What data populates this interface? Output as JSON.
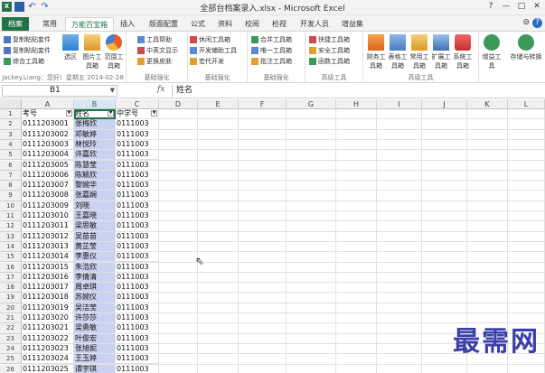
{
  "window": {
    "title": "全部台档案录入.xlsx - Microsoft Excel",
    "controls": [
      "?",
      "—",
      "□",
      "✕"
    ]
  },
  "tabs": [
    "档案",
    "常用",
    "万能百宝箱",
    "插入",
    "版面配置",
    "公式",
    "资料",
    "校阅",
    "检视",
    "开发人员",
    "增益集"
  ],
  "tab_right": [
    "⊝",
    "?"
  ],
  "ribbon": {
    "g1": {
      "rows": [
        "复制粘贴套件",
        "复制粘贴套件",
        "综合工具箱"
      ],
      "big": [
        "选区",
        "图片工具箱",
        "范围工具箱"
      ],
      "label": "Jackey.Liang：您好！星期五 2014-02-28"
    },
    "g2": {
      "rows": [
        "工具帮助",
        "中英文显示",
        "更换皮肤"
      ],
      "label": "基础强化"
    },
    "g3": {
      "rows": [
        "休闲工具箱",
        "开发辅助工具",
        "宏代开发"
      ],
      "label": "基础强化"
    },
    "g4": {
      "rows": [
        "合并工具箱",
        "唯一工具箱",
        "批注工具箱"
      ],
      "label": "基础强化"
    },
    "g5": {
      "rows": [
        "快捷工具箱",
        "安全工具箱",
        "函数工具箱"
      ],
      "label": "高级工具"
    },
    "g6": {
      "big": [
        "财务工具箱",
        "表格工具箱",
        "常用工具箱",
        "扩展工具箱",
        "系统工具箱"
      ],
      "label": "高级工具"
    },
    "g7": {
      "big": [
        "增益工具",
        "存储与转换"
      ],
      "label": ""
    }
  },
  "formula_bar": {
    "name_box": "B1",
    "fx": "fx",
    "value": "姓名"
  },
  "columns": [
    "A",
    "B",
    "C",
    "D",
    "E",
    "F",
    "G",
    "H",
    "I",
    "J",
    "K",
    "L",
    "M"
  ],
  "headers": {
    "a": "考号",
    "b": "姓名",
    "c": "中学号"
  },
  "rows": [
    {
      "n": "1"
    },
    {
      "n": "2",
      "a": "0111203001",
      "b": "张梅欣",
      "c": "0111003"
    },
    {
      "n": "3",
      "a": "0111203002",
      "b": "邓敏婷",
      "c": "0111003"
    },
    {
      "n": "4",
      "a": "0111203003",
      "b": "林悦玲",
      "c": "0111003"
    },
    {
      "n": "5",
      "a": "0111203004",
      "b": "许嘉欣",
      "c": "0111003"
    },
    {
      "n": "6",
      "a": "0111203005",
      "b": "陈慧莹",
      "c": "0111003"
    },
    {
      "n": "7",
      "a": "0111203006",
      "b": "陈颖欣",
      "c": "0111003"
    },
    {
      "n": "8",
      "a": "0111203007",
      "b": "黎婉华",
      "c": "0111003"
    },
    {
      "n": "9",
      "a": "0111203008",
      "b": "张嘉娴",
      "c": "0111003"
    },
    {
      "n": "10",
      "a": "0111203009",
      "b": "刘晓",
      "c": "0111003"
    },
    {
      "n": "11",
      "a": "0111203010",
      "b": "王嘉晓",
      "c": "0111003"
    },
    {
      "n": "12",
      "a": "0111203011",
      "b": "梁思敏",
      "c": "0111003"
    },
    {
      "n": "13",
      "a": "0111203012",
      "b": "吴苗苗",
      "c": "0111003"
    },
    {
      "n": "14",
      "a": "0111203013",
      "b": "黄芷莹",
      "c": "0111003"
    },
    {
      "n": "15",
      "a": "0111203014",
      "b": "李惠仪",
      "c": "0111003"
    },
    {
      "n": "16",
      "a": "0111203015",
      "b": "朱浩欣",
      "c": "0111003"
    },
    {
      "n": "17",
      "a": "0111203016",
      "b": "李倩清",
      "c": "0111003"
    },
    {
      "n": "18",
      "a": "0111203017",
      "b": "周卓琪",
      "c": "0111003"
    },
    {
      "n": "19",
      "a": "0111203018",
      "b": "苏婉仪",
      "c": "0111003"
    },
    {
      "n": "20",
      "a": "0111203019",
      "b": "吴洁莹",
      "c": "0111003"
    },
    {
      "n": "21",
      "a": "0111203020",
      "b": "许莎莎",
      "c": "0111003"
    },
    {
      "n": "22",
      "a": "0111203021",
      "b": "梁勇敏",
      "c": "0111003"
    },
    {
      "n": "23",
      "a": "0111203022",
      "b": "叶俊宏",
      "c": "0111003"
    },
    {
      "n": "24",
      "a": "0111203023",
      "b": "张旭妮",
      "c": "0111003"
    },
    {
      "n": "25",
      "a": "0111203024",
      "b": "王玉婷",
      "c": "0111003"
    },
    {
      "n": "26",
      "a": "0111203025",
      "b": "谭宇琪",
      "c": "0111003"
    }
  ],
  "watermark": "最需网"
}
